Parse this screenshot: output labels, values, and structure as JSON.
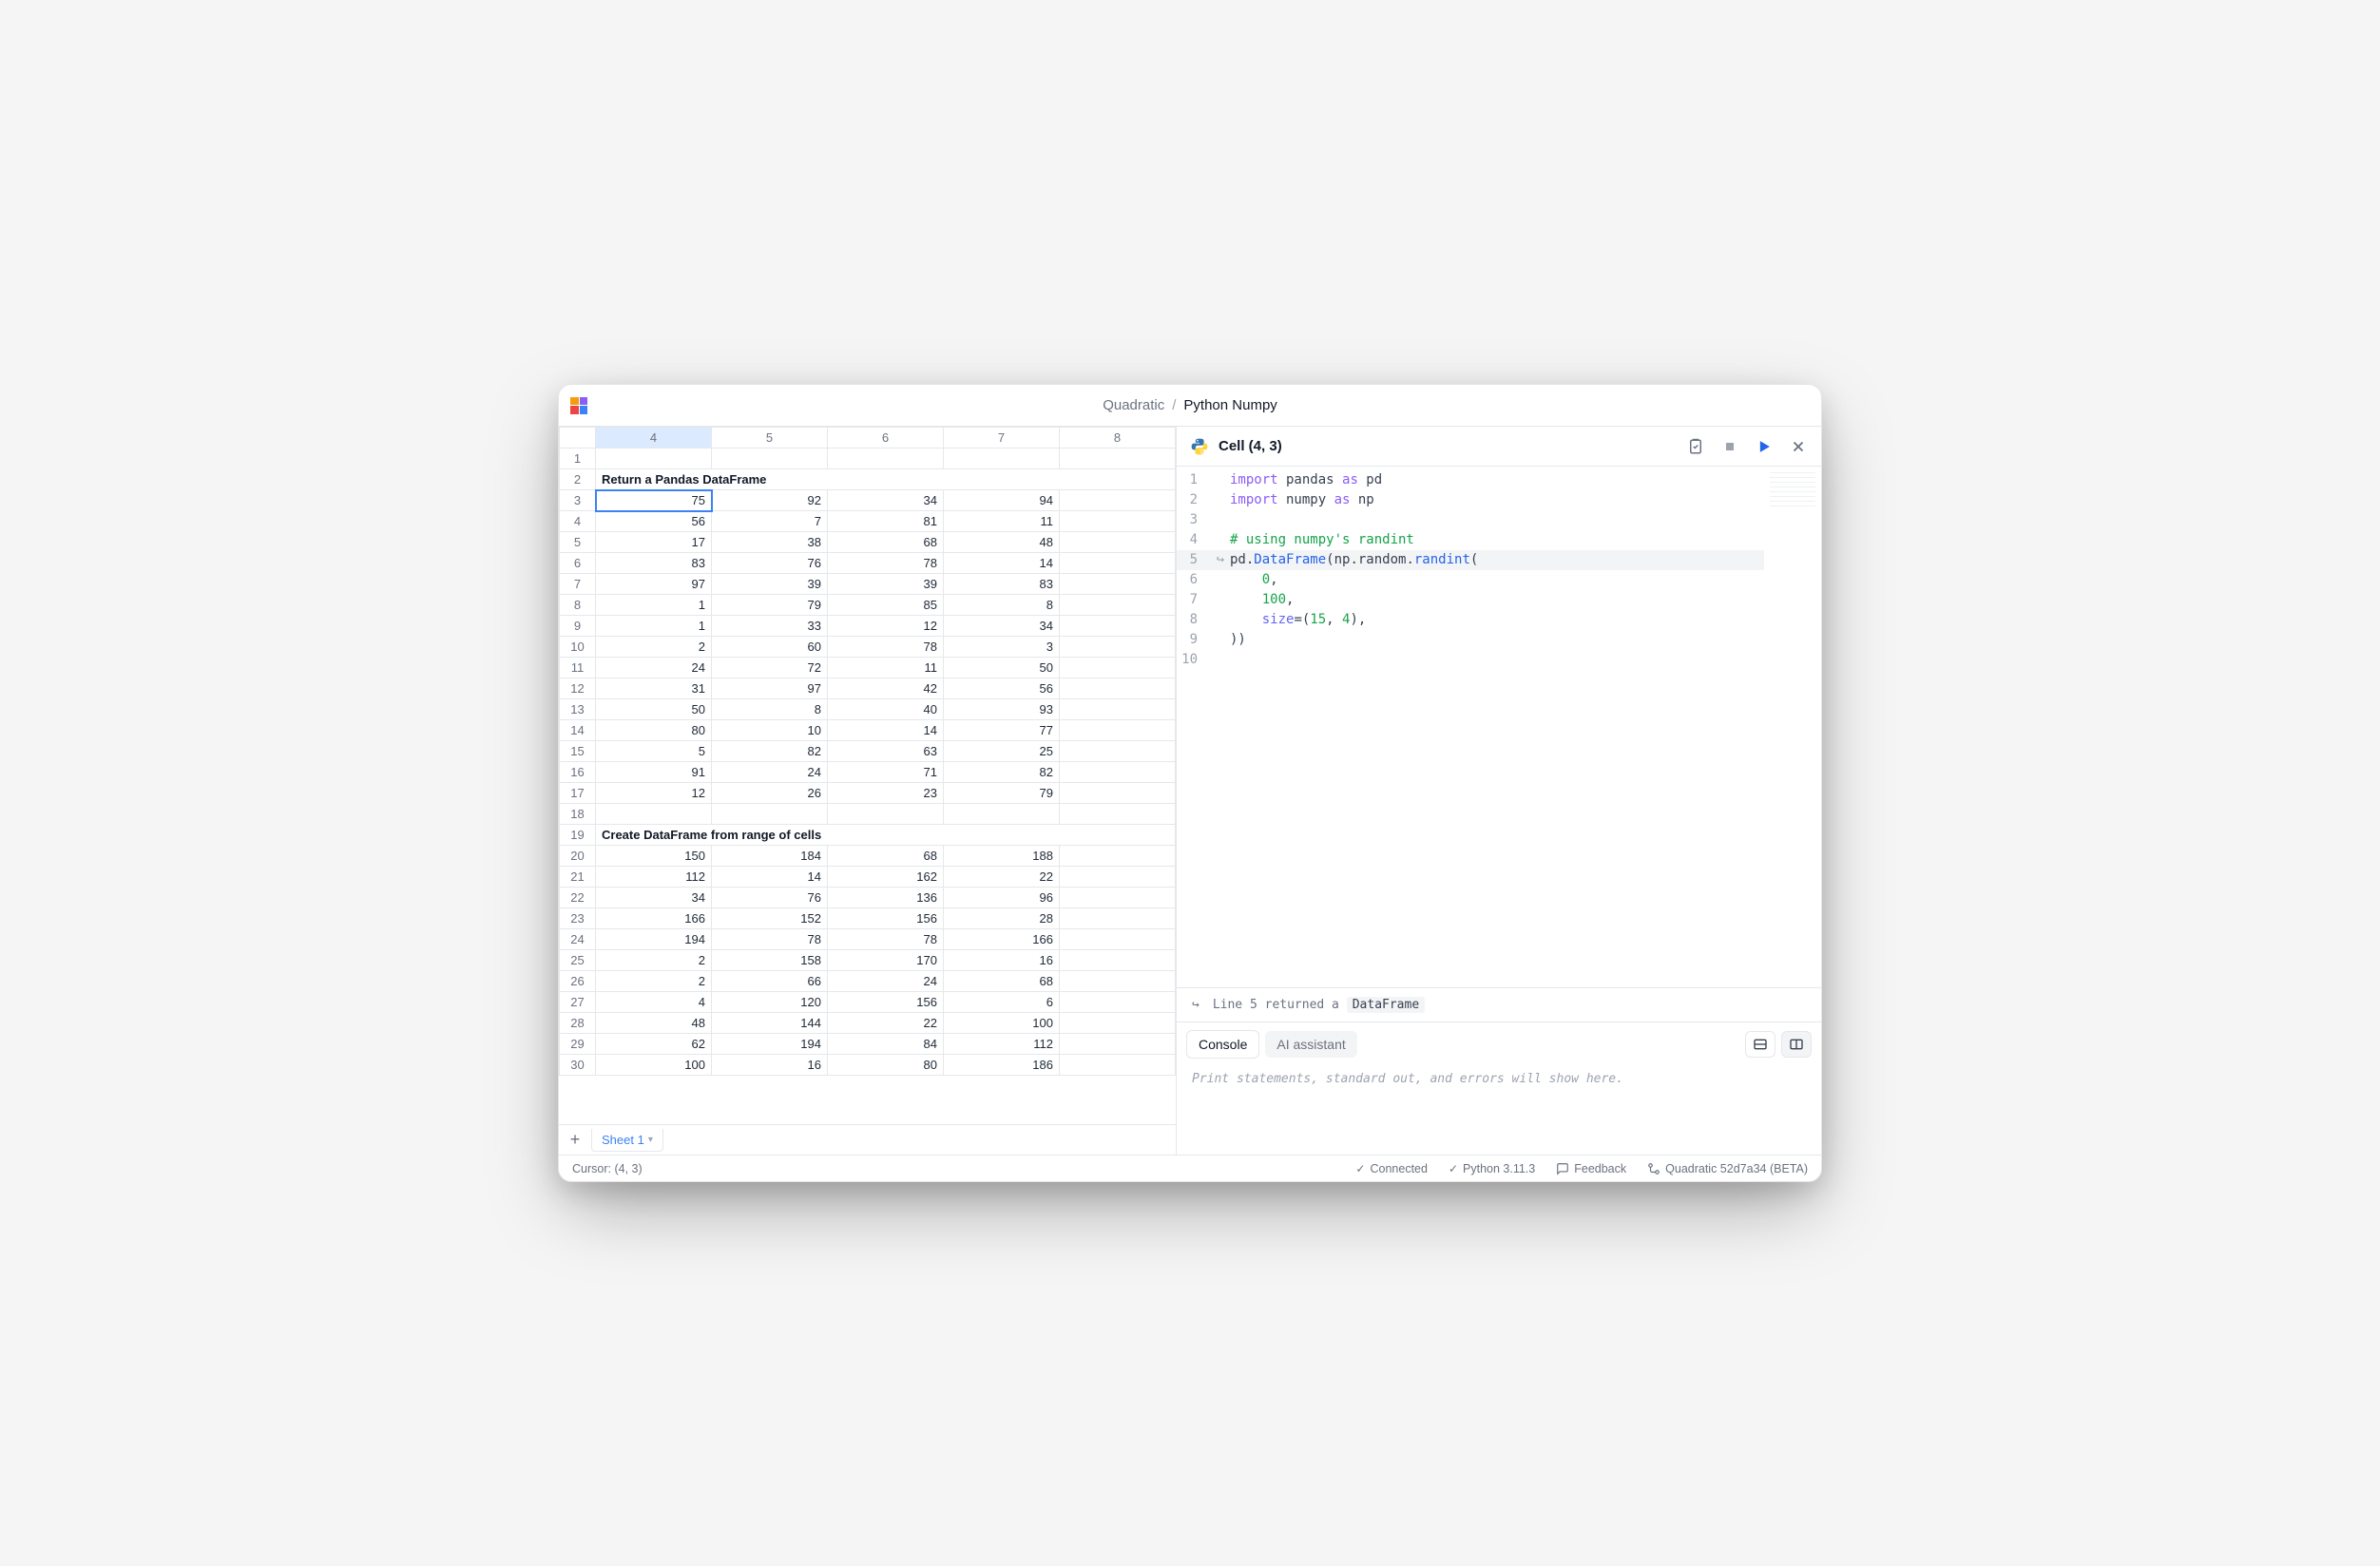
{
  "title": {
    "app": "Quadratic",
    "doc": "Python Numpy"
  },
  "spreadsheet": {
    "columns": [
      "4",
      "5",
      "6",
      "7",
      "8"
    ],
    "selected_col": "4",
    "selected_cell": {
      "row": 3,
      "col": "4"
    },
    "heading1": {
      "row": 2,
      "text": "Return a Pandas DataFrame"
    },
    "heading2": {
      "row": 19,
      "text": "Create DataFrame from range of cells"
    },
    "block1_rows": [
      {
        "r": 3,
        "v": [
          "75",
          "92",
          "34",
          "94",
          ""
        ]
      },
      {
        "r": 4,
        "v": [
          "56",
          "7",
          "81",
          "11",
          ""
        ]
      },
      {
        "r": 5,
        "v": [
          "17",
          "38",
          "68",
          "48",
          ""
        ]
      },
      {
        "r": 6,
        "v": [
          "83",
          "76",
          "78",
          "14",
          ""
        ]
      },
      {
        "r": 7,
        "v": [
          "97",
          "39",
          "39",
          "83",
          ""
        ]
      },
      {
        "r": 8,
        "v": [
          "1",
          "79",
          "85",
          "8",
          ""
        ]
      },
      {
        "r": 9,
        "v": [
          "1",
          "33",
          "12",
          "34",
          ""
        ]
      },
      {
        "r": 10,
        "v": [
          "2",
          "60",
          "78",
          "3",
          ""
        ]
      },
      {
        "r": 11,
        "v": [
          "24",
          "72",
          "11",
          "50",
          ""
        ]
      },
      {
        "r": 12,
        "v": [
          "31",
          "97",
          "42",
          "56",
          ""
        ]
      },
      {
        "r": 13,
        "v": [
          "50",
          "8",
          "40",
          "93",
          ""
        ]
      },
      {
        "r": 14,
        "v": [
          "80",
          "10",
          "14",
          "77",
          ""
        ]
      },
      {
        "r": 15,
        "v": [
          "5",
          "82",
          "63",
          "25",
          ""
        ]
      },
      {
        "r": 16,
        "v": [
          "91",
          "24",
          "71",
          "82",
          ""
        ]
      },
      {
        "r": 17,
        "v": [
          "12",
          "26",
          "23",
          "79",
          ""
        ]
      }
    ],
    "block2_rows": [
      {
        "r": 20,
        "v": [
          "150",
          "184",
          "68",
          "188",
          ""
        ]
      },
      {
        "r": 21,
        "v": [
          "112",
          "14",
          "162",
          "22",
          ""
        ]
      },
      {
        "r": 22,
        "v": [
          "34",
          "76",
          "136",
          "96",
          ""
        ]
      },
      {
        "r": 23,
        "v": [
          "166",
          "152",
          "156",
          "28",
          ""
        ]
      },
      {
        "r": 24,
        "v": [
          "194",
          "78",
          "78",
          "166",
          ""
        ]
      },
      {
        "r": 25,
        "v": [
          "2",
          "158",
          "170",
          "16",
          ""
        ]
      },
      {
        "r": 26,
        "v": [
          "2",
          "66",
          "24",
          "68",
          ""
        ]
      },
      {
        "r": 27,
        "v": [
          "4",
          "120",
          "156",
          "6",
          ""
        ]
      },
      {
        "r": 28,
        "v": [
          "48",
          "144",
          "22",
          "100",
          ""
        ]
      },
      {
        "r": 29,
        "v": [
          "62",
          "194",
          "84",
          "112",
          ""
        ]
      },
      {
        "r": 30,
        "v": [
          "100",
          "16",
          "80",
          "186",
          ""
        ]
      }
    ],
    "sheet_tab": "Sheet 1"
  },
  "code": {
    "cell_ref": "Cell (4, 3)",
    "lines": [
      {
        "n": 1,
        "seg": [
          {
            "c": "kw",
            "t": "import"
          },
          {
            "c": "pn",
            "t": " pandas "
          },
          {
            "c": "kw",
            "t": "as"
          },
          {
            "c": "pn",
            "t": " pd"
          }
        ]
      },
      {
        "n": 2,
        "seg": [
          {
            "c": "kw",
            "t": "import"
          },
          {
            "c": "pn",
            "t": " numpy "
          },
          {
            "c": "kw",
            "t": "as"
          },
          {
            "c": "pn",
            "t": " np"
          }
        ]
      },
      {
        "n": 3,
        "seg": []
      },
      {
        "n": 4,
        "seg": [
          {
            "c": "cm",
            "t": "# using numpy's randint"
          }
        ]
      },
      {
        "n": 5,
        "hl": true,
        "arrow": true,
        "seg": [
          {
            "c": "pn",
            "t": "pd."
          },
          {
            "c": "bluefn",
            "t": "DataFrame"
          },
          {
            "c": "pn",
            "t": "(np.random."
          },
          {
            "c": "bluefn",
            "t": "randint"
          },
          {
            "c": "pn",
            "t": "("
          }
        ]
      },
      {
        "n": 6,
        "seg": [
          {
            "c": "pn",
            "t": "    "
          },
          {
            "c": "nm",
            "t": "0"
          },
          {
            "c": "pn",
            "t": ","
          }
        ]
      },
      {
        "n": 7,
        "seg": [
          {
            "c": "pn",
            "t": "    "
          },
          {
            "c": "nm",
            "t": "100"
          },
          {
            "c": "pn",
            "t": ","
          }
        ]
      },
      {
        "n": 8,
        "seg": [
          {
            "c": "pn",
            "t": "    "
          },
          {
            "c": "fn",
            "t": "size"
          },
          {
            "c": "pn",
            "t": "=("
          },
          {
            "c": "nm",
            "t": "15"
          },
          {
            "c": "pn",
            "t": ", "
          },
          {
            "c": "nm",
            "t": "4"
          },
          {
            "c": "pn",
            "t": "),"
          }
        ]
      },
      {
        "n": 9,
        "seg": [
          {
            "c": "pn",
            "t": "))"
          }
        ]
      },
      {
        "n": 10,
        "seg": []
      }
    ],
    "return_msg_prefix": "Line 5 returned a ",
    "return_tag": "DataFrame"
  },
  "console": {
    "tab_console": "Console",
    "tab_ai": "AI assistant",
    "placeholder": "Print statements, standard out, and errors will show here."
  },
  "status": {
    "cursor": "Cursor: (4, 3)",
    "connected": "Connected",
    "python": "Python 3.11.3",
    "feedback": "Feedback",
    "build": "Quadratic 52d7a34 (BETA)"
  }
}
